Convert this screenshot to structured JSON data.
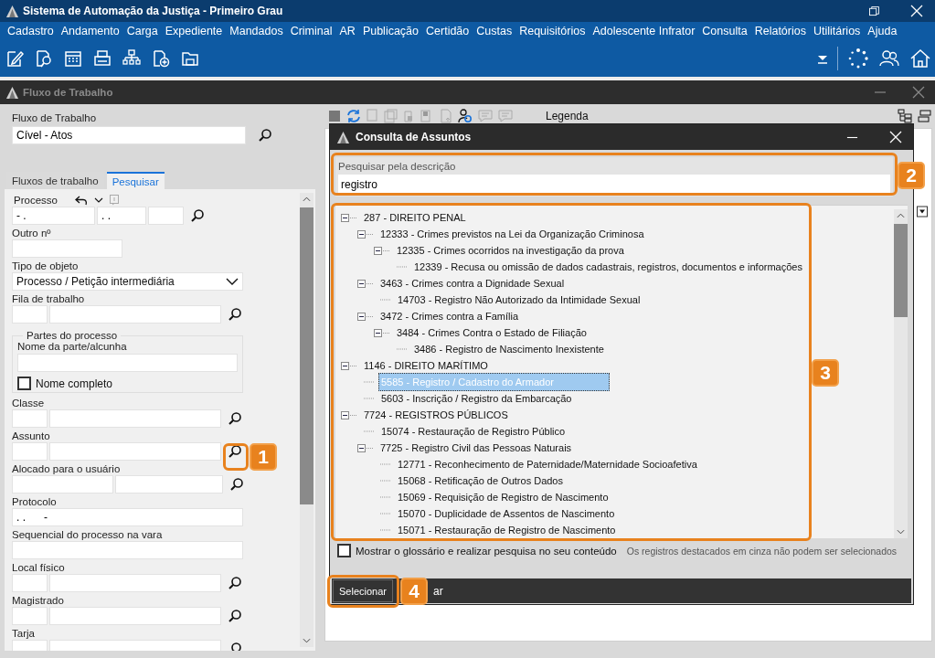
{
  "app_window": {
    "title": "Sistema de Automação da Justiça - Primeiro Grau"
  },
  "menu": [
    "Cadastro",
    "Andamento",
    "Carga",
    "Expediente",
    "Mandados",
    "Criminal",
    "AR",
    "Publicação",
    "Certidão",
    "Custas",
    "Requisitórios",
    "Adolescente Infrator",
    "Consulta",
    "Relatórios",
    "Utilitários",
    "Ajuda"
  ],
  "workflow_window": {
    "title": "Fluxo de Trabalho"
  },
  "workflow_field": {
    "label": "Fluxo de Trabalho",
    "value": "Cível - Atos"
  },
  "tabs": [
    {
      "label": "Fluxos de trabalho",
      "selected": false
    },
    {
      "label": "Pesquisar",
      "selected": true
    }
  ],
  "search_form": [
    {
      "kind": "process",
      "label": "Processo",
      "values": [
        "- .",
        ". ."
      ]
    },
    {
      "kind": "short-text",
      "label": "Outro nº"
    },
    {
      "kind": "select",
      "label": "Tipo de objeto",
      "value": "Processo / Petição intermediária"
    },
    {
      "kind": "lookup",
      "label": "Fila de trabalho"
    },
    {
      "kind": "group",
      "label": "Partes do processo",
      "field_label": "Nome da parte/alcunha",
      "checkbox": {
        "label": "Nome completo",
        "checked": false
      }
    },
    {
      "kind": "lookup",
      "label": "Classe"
    },
    {
      "kind": "lookup",
      "label": "Assunto"
    },
    {
      "kind": "user-lookup",
      "label": "Alocado para o usuário"
    },
    {
      "kind": "text",
      "label": "Protocolo",
      "value": ". .      -"
    },
    {
      "kind": "text",
      "label": "Sequencial do processo na vara"
    },
    {
      "kind": "lookup",
      "label": "Local físico"
    },
    {
      "kind": "lookup",
      "label": "Magistrado"
    },
    {
      "kind": "lookup",
      "label": "Tarja"
    }
  ],
  "right_toolbar": {
    "legend": "Legenda"
  },
  "dialog": {
    "title": "Consulta de Assuntos",
    "search_label": "Pesquisar pela descrição",
    "search_value": "registro",
    "tree": [
      {
        "label": "287 - DIREITO PENAL",
        "expanded": true,
        "selected": false,
        "children": [
          {
            "label": "12333 - Crimes previstos na Lei da Organização Criminosa",
            "expanded": true,
            "selected": false,
            "children": [
              {
                "label": "12335 - Crimes ocorridos na investigação da prova",
                "expanded": true,
                "selected": false,
                "children": [
                  {
                    "label": "12339 - Recusa ou omissão de dados cadastrais, registros, documentos e informações",
                    "selected": false
                  }
                ]
              }
            ]
          },
          {
            "label": "3463 - Crimes contra a Dignidade Sexual",
            "expanded": true,
            "selected": false,
            "children": [
              {
                "label": "14703 - Registro Não Autorizado da Intimidade Sexual",
                "selected": false
              }
            ]
          },
          {
            "label": "3472 - Crimes contra a Família",
            "expanded": true,
            "selected": false,
            "children": [
              {
                "label": "3484 - Crimes Contra o Estado de Filiação",
                "expanded": true,
                "selected": false,
                "children": [
                  {
                    "label": "3486 - Registro de Nascimento Inexistente",
                    "selected": false
                  }
                ]
              }
            ]
          }
        ]
      },
      {
        "label": "1146 - DIREITO MARÍTIMO",
        "expanded": true,
        "selected": false,
        "children": [
          {
            "label": "5585 - Registro / Cadastro do Armador",
            "selected": true
          },
          {
            "label": "5603 - Inscrição / Registro da Embarcação",
            "selected": false
          }
        ]
      },
      {
        "label": "7724 - REGISTROS PÚBLICOS",
        "expanded": true,
        "selected": false,
        "children": [
          {
            "label": "15074 - Restauração de Registro Público",
            "selected": false
          },
          {
            "label": "7725 - Registro Civil das Pessoas Naturais",
            "expanded": true,
            "selected": false,
            "children": [
              {
                "label": "12771 - Reconhecimento de Paternidade/Maternidade Socioafetiva",
                "selected": false
              },
              {
                "label": "15068 - Retificação de Outros Dados",
                "selected": false
              },
              {
                "label": "15069 - Requisição de Registro de Nascimento",
                "selected": false
              },
              {
                "label": "15070 - Duplicidade de Assentos de Nascimento",
                "selected": false
              },
              {
                "label": "15071 - Restauração de Registro de Nascimento",
                "selected": false
              }
            ]
          }
        ]
      }
    ],
    "glossary_checkbox": {
      "label": "Mostrar o glossário e realizar pesquisa no seu conteúdo",
      "checked": false
    },
    "note": "Os registros destacados em cinza não podem ser selecionados",
    "buttons": [
      {
        "label": "Selecionar"
      },
      {
        "label": "ar"
      }
    ]
  },
  "callouts": [
    "1",
    "2",
    "3",
    "4"
  ]
}
